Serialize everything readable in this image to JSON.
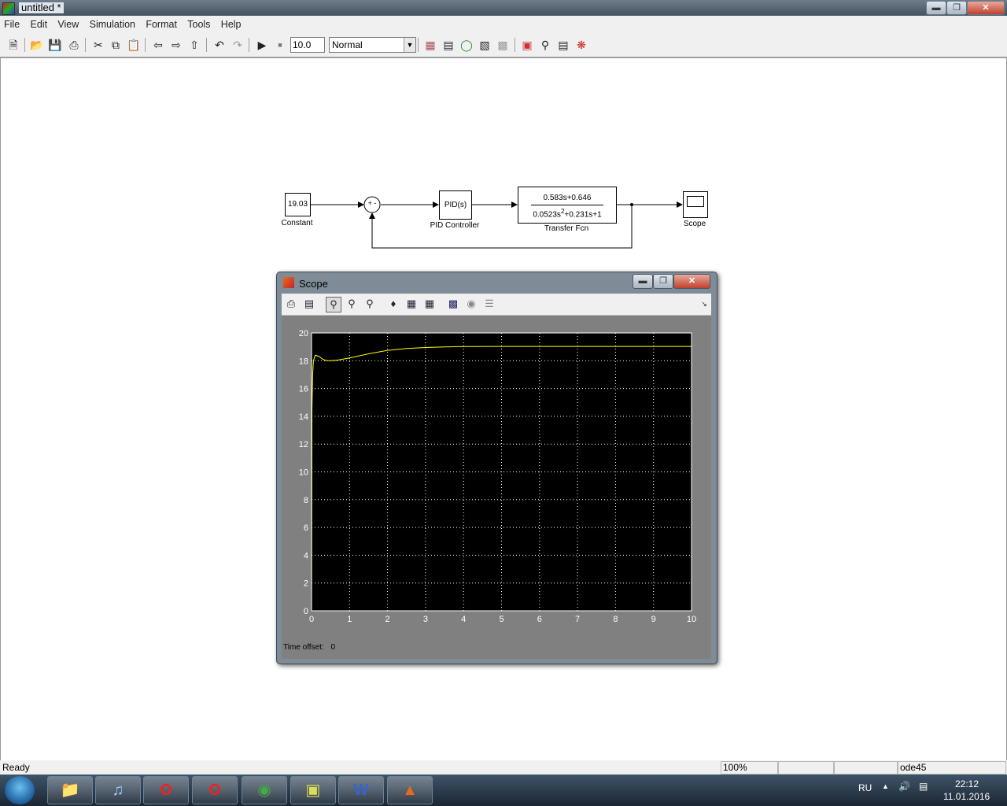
{
  "window": {
    "title": "untitled *"
  },
  "menu": [
    "File",
    "Edit",
    "View",
    "Simulation",
    "Format",
    "Tools",
    "Help"
  ],
  "toolbar": {
    "stop_time": "10.0",
    "sim_mode": "Normal",
    "icons": [
      "new-icon",
      "open-icon",
      "save-icon",
      "print-icon",
      "cut-icon",
      "copy-icon",
      "paste-icon",
      "back-icon",
      "forward-icon",
      "up-icon",
      "undo-icon",
      "redo-icon",
      "play-icon",
      "stop-icon",
      "library-browser-icon",
      "model-explorer-icon",
      "debugger-icon",
      "build-icon",
      "refresh-icon",
      "port-values-icon",
      "find-icon",
      "model-advisor-icon",
      "help-icon"
    ]
  },
  "diagram": {
    "constant": {
      "value": "19.03",
      "label": "Constant"
    },
    "sum": {
      "signs": "+ -"
    },
    "pid": {
      "text": "PID(s)",
      "label": "PID Controller"
    },
    "tf": {
      "num": "0.583s+0.646",
      "den_pre": "0.0523s",
      "den_exp": "2",
      "den_post": "+0.231s+1",
      "label": "Transfer Fcn"
    },
    "scope": {
      "label": "Scope"
    }
  },
  "scope_window": {
    "title": "Scope",
    "time_offset_label": "Time offset:",
    "time_offset_value": "0",
    "colors": {
      "background": "#000000",
      "trace": "#ffff00",
      "grid": "#ffffff"
    }
  },
  "chart_data": {
    "type": "line",
    "title": "",
    "xlabel": "",
    "ylabel": "",
    "xlim": [
      0,
      10
    ],
    "ylim": [
      0,
      20
    ],
    "xticks": [
      0,
      1,
      2,
      3,
      4,
      5,
      6,
      7,
      8,
      9,
      10
    ],
    "yticks": [
      0,
      2,
      4,
      6,
      8,
      10,
      12,
      14,
      16,
      18,
      20
    ],
    "grid": true,
    "series": [
      {
        "x": [
          0,
          0.01,
          0.03,
          0.05,
          0.1,
          0.2,
          0.3,
          0.4,
          0.5,
          0.7,
          1.0,
          1.5,
          2.0,
          2.5,
          3.0,
          3.5,
          4.0,
          5.0,
          6.0,
          7.0,
          8.0,
          9.0,
          10.0
        ],
        "y": [
          0,
          14.5,
          17.0,
          18.0,
          18.4,
          18.3,
          18.1,
          18.0,
          18.0,
          18.05,
          18.2,
          18.5,
          18.75,
          18.88,
          18.95,
          19.0,
          19.02,
          19.03,
          19.03,
          19.03,
          19.03,
          19.03,
          19.03
        ]
      }
    ]
  },
  "status": {
    "left": "Ready",
    "zoom": "100%",
    "solver": "ode45"
  },
  "taskbar": {
    "apps": [
      "explorer-icon",
      "music-icon",
      "opera-icon",
      "opera-icon",
      "chrome-icon",
      "notes-icon",
      "word-icon",
      "matlab-icon"
    ],
    "lang": "RU",
    "time": "22:12",
    "date": "11.01.2016"
  }
}
